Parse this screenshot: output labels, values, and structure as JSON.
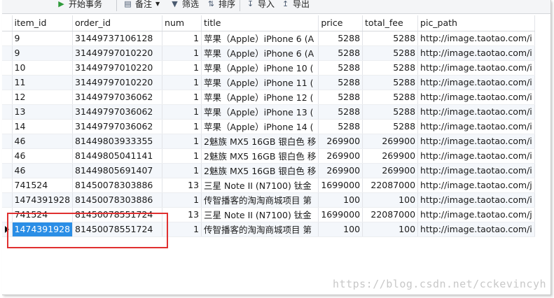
{
  "toolbar": {
    "items": [
      {
        "label": "开始事务",
        "icon": "play-icon"
      },
      {
        "label": "备注",
        "icon": "note-icon"
      },
      {
        "label": "筛选",
        "icon": "filter-icon"
      },
      {
        "label": "排序",
        "icon": "sort-icon"
      },
      {
        "label": "导入",
        "icon": "import-icon"
      },
      {
        "label": "导出",
        "icon": "export-icon"
      }
    ]
  },
  "table": {
    "columns": [
      "item_id",
      "order_id",
      "num",
      "title",
      "price",
      "total_fee",
      "pic_path"
    ],
    "rows": [
      [
        "9",
        "31449737106128",
        "1",
        "苹果（Apple）iPhone 6 (A",
        "5288",
        "5288",
        "http://image.taotao.com/i"
      ],
      [
        "9",
        "31449797010220",
        "1",
        "苹果（Apple）iPhone 6 (A",
        "5288",
        "5288",
        "http://image.taotao.com/i"
      ],
      [
        "10",
        "31449797010220",
        "1",
        "苹果（Apple）iPhone 10 (",
        "5288",
        "5288",
        "http://image.taotao.com/i"
      ],
      [
        "11",
        "31449797010220",
        "1",
        "苹果（Apple）iPhone 11 (",
        "5288",
        "5288",
        "http://image.taotao.com/i"
      ],
      [
        "12",
        "31449797036062",
        "1",
        "苹果（Apple）iPhone 12 (",
        "5288",
        "5288",
        "http://image.taotao.com/i"
      ],
      [
        "13",
        "31449797036062",
        "1",
        "苹果（Apple）iPhone 13 (",
        "5288",
        "5288",
        "http://image.taotao.com/i"
      ],
      [
        "14",
        "31449797036062",
        "1",
        "苹果（Apple）iPhone 14 (",
        "5288",
        "5288",
        "http://image.taotao.com/i"
      ],
      [
        "46",
        "81449803933355",
        "1",
        "2魅族 MX5 16GB 银白色 移",
        "269900",
        "269900",
        "http://image.taotao.com/i"
      ],
      [
        "46",
        "81449805041141",
        "1",
        "2魅族 MX5 16GB 银白色 移",
        "269900",
        "269900",
        "http://image.taotao.com/i"
      ],
      [
        "46",
        "81449805691407",
        "1",
        "2魅族 MX5 16GB 银白色 移",
        "269900",
        "269900",
        "http://image.taotao.com/i"
      ],
      [
        "741524",
        "81450078303886",
        "13",
        "三星 Note II (N7100) 钛金",
        "1699000",
        "22087000",
        "http://image.taotao.com/j"
      ],
      [
        "1474391928",
        "81450078303886",
        "1",
        "传智播客的淘淘商城项目 第",
        "100",
        "100",
        "http://image.taotao.com/i"
      ],
      [
        "741524",
        "81450078551724",
        "13",
        "三星 Note II (N7100) 钛金",
        "1699000",
        "22087000",
        "http://image.taotao.com/j"
      ],
      [
        "1474391928",
        "81450078551724",
        "1",
        "传智播客的淘淘商城项目 第",
        "100",
        "100",
        "http://image.taotao.com/i"
      ]
    ],
    "selected_row": 13,
    "selected_col": 0
  },
  "watermark": "https://blog.csdn.net/cckevincyh",
  "colors": {
    "selection": "#2a8ee6",
    "highlight_box": "#e03030",
    "alt_row": "#f4f7fb"
  }
}
